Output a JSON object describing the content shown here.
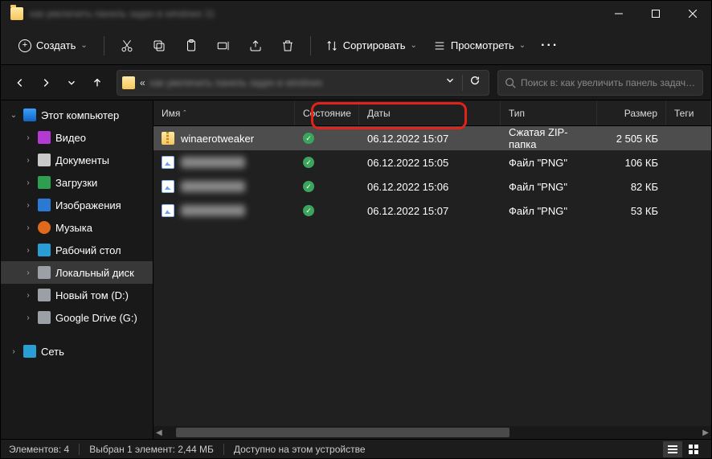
{
  "title_blurred": "как увеличить панель задач в windows 11",
  "toolbar": {
    "new_label": "Создать",
    "sort_label": "Сортировать",
    "view_label": "Просмотреть"
  },
  "address": {
    "prefix": "«",
    "path_blurred": "как увеличить панель задач в windows"
  },
  "search_placeholder": "Поиск в: как увеличить панель задач в...",
  "sidebar": {
    "this_pc": "Этот компьютер",
    "items": [
      {
        "label": "Видео"
      },
      {
        "label": "Документы"
      },
      {
        "label": "Загрузки"
      },
      {
        "label": "Изображения"
      },
      {
        "label": "Музыка"
      },
      {
        "label": "Рабочий стол"
      },
      {
        "label": "Локальный диск"
      },
      {
        "label": "Новый том (D:)"
      },
      {
        "label": "Google Drive (G:)"
      }
    ],
    "network": "Сеть"
  },
  "columns": {
    "name": "Имя",
    "state": "Состояние",
    "date": "Даты",
    "type": "Тип",
    "size": "Размер",
    "tags": "Теги"
  },
  "rows": [
    {
      "name": "winaerotweaker",
      "kind": "zip",
      "date": "06.12.2022 15:07",
      "type": "Сжатая ZIP-папка",
      "size": "2 505 КБ",
      "blurred": false,
      "selected": true
    },
    {
      "name": "file1",
      "kind": "png",
      "date": "06.12.2022 15:05",
      "type": "Файл \"PNG\"",
      "size": "106 КБ",
      "blurred": true,
      "selected": false
    },
    {
      "name": "file2",
      "kind": "png",
      "date": "06.12.2022 15:06",
      "type": "Файл \"PNG\"",
      "size": "82 КБ",
      "blurred": true,
      "selected": false
    },
    {
      "name": "file3",
      "kind": "png",
      "date": "06.12.2022 15:07",
      "type": "Файл \"PNG\"",
      "size": "53 КБ",
      "blurred": true,
      "selected": false
    }
  ],
  "status": {
    "items": "Элементов: 4",
    "selected": "Выбран 1 элемент: 2,44 МБ",
    "avail": "Доступно на этом устройстве"
  }
}
